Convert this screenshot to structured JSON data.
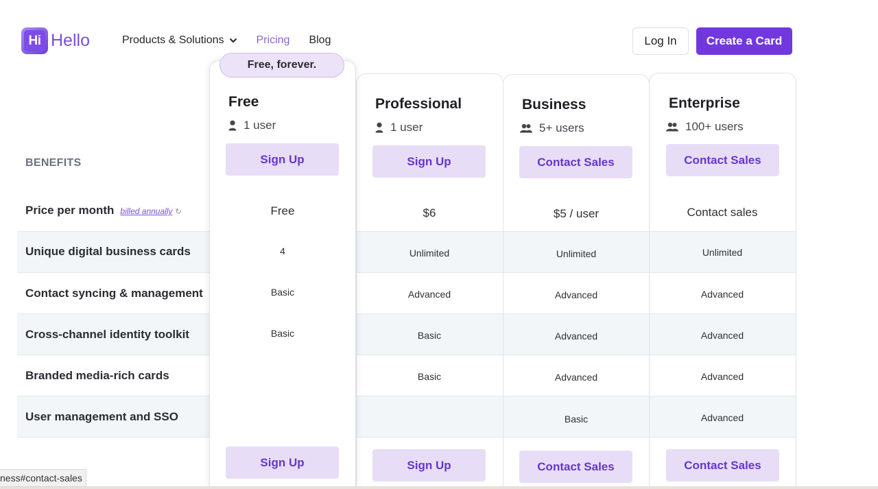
{
  "brand": {
    "badge_text": "Hi",
    "word": "Hello",
    "accent": "#7139dd"
  },
  "nav": {
    "items": [
      {
        "label": "Products & Solutions",
        "has_chevron": true
      },
      {
        "label": "Pricing",
        "active": true
      },
      {
        "label": "Blog"
      }
    ]
  },
  "header": {
    "login_label": "Log In",
    "create_label": "Create a Card"
  },
  "free_badge": "Free, forever.",
  "benefits_title": "BENEFITS",
  "rows": {
    "price": {
      "label": "Price per month",
      "billed": "billed annually",
      "billed_icon": "↻"
    },
    "r1": "Unique digital business cards",
    "r2": "Contact syncing & management",
    "r3": "Cross-channel identity toolkit",
    "r4": "Branded media-rich cards",
    "r5": "User management and SSO"
  },
  "plans": {
    "free": {
      "name": "Free",
      "users": "1 user",
      "users_icon": "user-icon",
      "cta": "Sign Up",
      "price": "Free",
      "cells": [
        "4",
        "Basic",
        "Basic",
        "",
        ""
      ]
    },
    "professional": {
      "name": "Professional",
      "users": "1 user",
      "users_icon": "user-icon",
      "cta": "Sign Up",
      "price": "$6",
      "cells": [
        "Unlimited",
        "Advanced",
        "Basic",
        "Basic",
        ""
      ]
    },
    "business": {
      "name": "Business",
      "users": "5+ users",
      "users_icon": "users-icon",
      "cta": "Contact Sales",
      "price": "$5 / user",
      "cells": [
        "Unlimited",
        "Advanced",
        "Advanced",
        "Advanced",
        "Basic"
      ]
    },
    "enterprise": {
      "name": "Enterprise",
      "users": "100+ users",
      "users_icon": "users-icon",
      "cta": "Contact Sales",
      "price": "Contact sales",
      "cells": [
        "Unlimited",
        "Advanced",
        "Advanced",
        "Advanced",
        "Advanced"
      ]
    }
  },
  "status_url": "ness#contact-sales"
}
